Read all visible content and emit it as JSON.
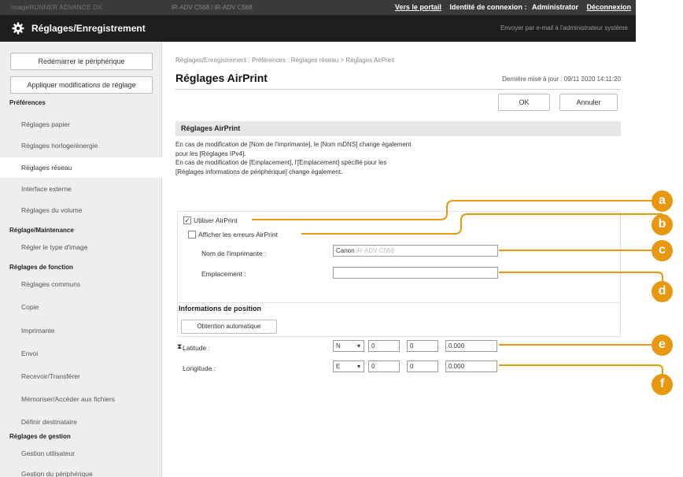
{
  "topbar": {
    "brand": "imageRUNNER ADVANCE DX",
    "device": "iR-ADV C568 / iR-ADV C568",
    "portal_link": "Vers le portail",
    "login_label": "Identité de connexion :",
    "login_user": "Administrator",
    "logout": "Déconnexion"
  },
  "titlebar": {
    "title": "Réglages/Enregistrement",
    "mail_link": "Envoyer par e-mail à l'administrateur système"
  },
  "sidebar": {
    "restart_button": "Redémarrer le périphérique",
    "apply_button": "Appliquer modifications de réglage",
    "sections": [
      {
        "label": "Préférences"
      },
      {
        "label": "Réglage/Maintenance"
      },
      {
        "label": "Réglages de fonction"
      },
      {
        "label": "Réglages de gestion"
      }
    ],
    "items": [
      {
        "label": "Réglages papier"
      },
      {
        "label": "Réglages horloge/énergie"
      },
      {
        "label": "Réglages réseau"
      },
      {
        "label": "Interface externe"
      },
      {
        "label": "Réglages du volume"
      },
      {
        "label": "Régler le type d'image"
      },
      {
        "label": "Réglages communs"
      },
      {
        "label": "Copie"
      },
      {
        "label": "Imprimante"
      },
      {
        "label": "Envoi"
      },
      {
        "label": "Recevoir/Transférer"
      },
      {
        "label": "Mémoriser/Accéder aux fichiers"
      },
      {
        "label": "Définir destinataire"
      },
      {
        "label": "Gestion utilisateur"
      },
      {
        "label": "Gestion du périphérique"
      }
    ]
  },
  "main": {
    "breadcrumb": "Réglages/Enregistrement : Préférences : Réglages réseau > Réglages AirPrint",
    "title": "Réglages AirPrint",
    "last_update": "Dernière mise à jour : 09/11 2020 14:11:20",
    "ok_button": "OK",
    "cancel_button": "Annuler",
    "section_title": "Réglages AirPrint",
    "desc_lines": [
      "En cas de modification de [Nom de l'imprimante], le [Nom mDNS] change également",
      "pour les [Réglages IPv4].",
      "En cas de modification de [Emplacement], l'[Emplacement] spécifié pour les",
      "[Réglages informations de périphérique] change également."
    ],
    "use_airprint_label": "Utiliser AirPrint",
    "use_airprint_checked": "✓",
    "show_errors_label": "Afficher les erreurs AirPrint",
    "printer_name_label": "Nom de l'imprimante :",
    "printer_name_value": "Canon",
    "printer_name_blurred": "iR-ADV C568",
    "location_label": "Emplacement :",
    "location_value": "",
    "position_info_title": "Informations de position",
    "auto_get_button": "Obtention automatique",
    "latitude_label": "Latitude :",
    "latitude_dir": "N",
    "latitude_deg": "0",
    "latitude_min": "0",
    "latitude_sec": "0.000",
    "longitude_label": "Longitude :",
    "longitude_dir": "E",
    "longitude_deg": "0",
    "longitude_min": "0",
    "longitude_sec": "0.000",
    "top_icon": "⧗"
  },
  "callouts": [
    "a",
    "b",
    "c",
    "d",
    "e",
    "f"
  ],
  "colors": {
    "callout": "#e8970f",
    "topbar": "#3a3a3a",
    "titlebar": "#1e1e1e",
    "sidebar": "#eeeeee"
  }
}
